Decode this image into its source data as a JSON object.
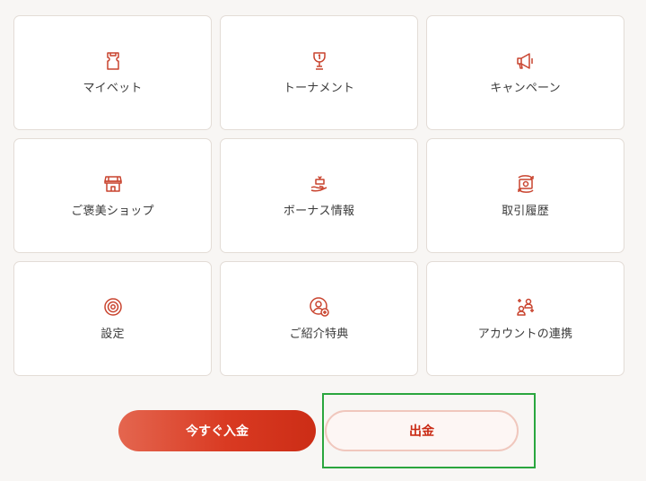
{
  "menu": {
    "tiles": [
      {
        "label": "マイベット",
        "icon": "ticket-icon"
      },
      {
        "label": "トーナメント",
        "icon": "trophy-icon"
      },
      {
        "label": "キャンペーン",
        "icon": "megaphone-icon"
      },
      {
        "label": "ご褒美ショップ",
        "icon": "shop-icon"
      },
      {
        "label": "ボーナス情報",
        "icon": "gift-hand-icon"
      },
      {
        "label": "取引履歴",
        "icon": "cash-exchange-icon"
      },
      {
        "label": "設定",
        "icon": "gear-icon"
      },
      {
        "label": "ご紹介特典",
        "icon": "add-user-icon"
      },
      {
        "label": "アカウントの連携",
        "icon": "link-account-icon"
      }
    ]
  },
  "actions": {
    "deposit_label": "今すぐ入金",
    "withdraw_label": "出金"
  },
  "colors": {
    "accent": "#d93a22",
    "icon": "#c9442f",
    "highlight": "#2aa63e"
  }
}
